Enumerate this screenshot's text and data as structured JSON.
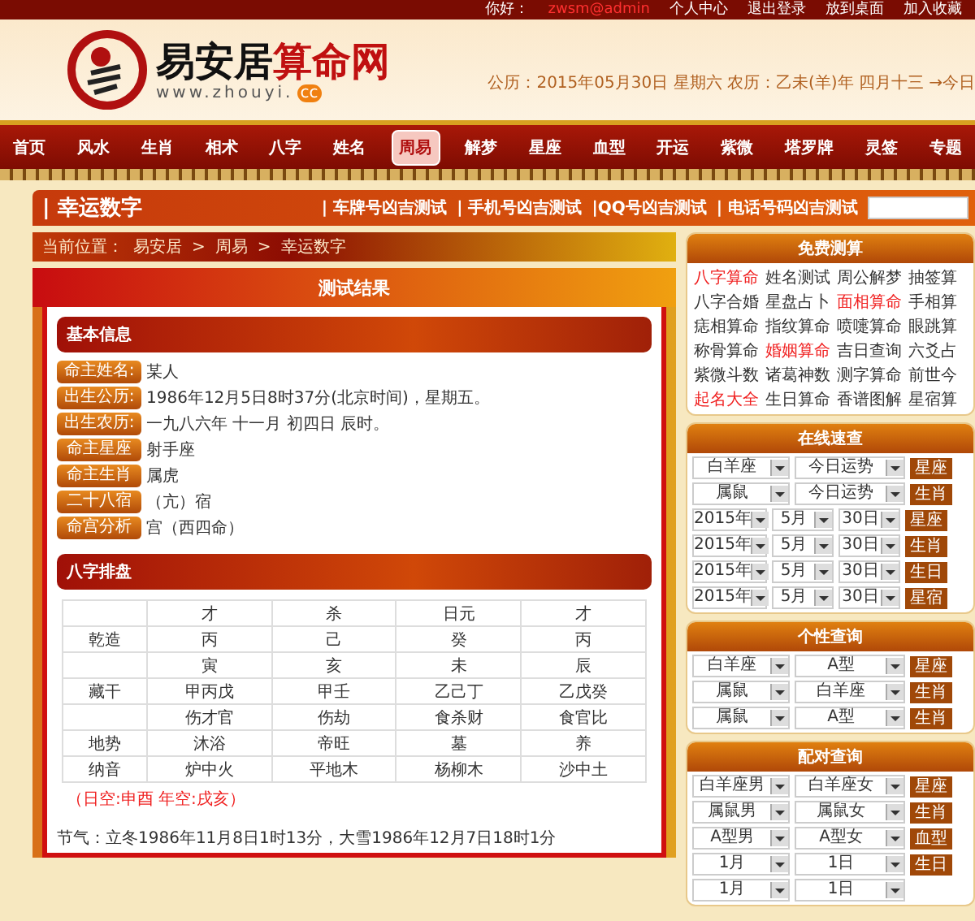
{
  "top_bar": {
    "greeting": "你好：",
    "user": "zwsm@admin",
    "links": [
      "个人中心",
      "退出登录",
      "放到桌面",
      "加入收藏"
    ]
  },
  "header": {
    "logo_title": "易安居",
    "logo_title_accent": "算命网",
    "logo_url": "www.zhouyi.",
    "logo_url_badge": "cc",
    "date": "公历：2015年05月30日 星期六 农历：乙未(羊)年 四月十三 →今日"
  },
  "nav": [
    {
      "label": "首页",
      "selected": false
    },
    {
      "label": "风水",
      "selected": false
    },
    {
      "label": "生肖",
      "selected": false
    },
    {
      "label": "相术",
      "selected": false
    },
    {
      "label": "八字",
      "selected": false
    },
    {
      "label": "姓名",
      "selected": false
    },
    {
      "label": "周易",
      "selected": true
    },
    {
      "label": "解梦",
      "selected": false
    },
    {
      "label": "星座",
      "selected": false
    },
    {
      "label": "血型",
      "selected": false
    },
    {
      "label": "开运",
      "selected": false
    },
    {
      "label": "紫微",
      "selected": false
    },
    {
      "label": "塔罗牌",
      "selected": false
    },
    {
      "label": "灵签",
      "selected": false
    },
    {
      "label": "专题",
      "selected": false
    }
  ],
  "title_bar": {
    "title": "| 幸运数字",
    "links": [
      "| 车牌号凶吉测试",
      "| 手机号凶吉测试",
      "|QQ号凶吉测试",
      "| 电话号码凶吉测试"
    ]
  },
  "breadcrumb": {
    "label": "当前位置：",
    "separator": ">",
    "items": [
      "易安居",
      "周易",
      "幸运数字"
    ]
  },
  "result": {
    "title": "测试结果",
    "basic_heading": "基本信息",
    "basic_rows": [
      {
        "label": "命主姓名:",
        "value": "某人"
      },
      {
        "label": "出生公历:",
        "value": "1986年12月5日8时37分(北京时间)，星期五。"
      },
      {
        "label": "出生农历:",
        "value": "一九八六年 十一月 初四日 辰时。"
      },
      {
        "label": "命主星座",
        "value": "射手座"
      },
      {
        "label": "命主生肖",
        "value": "属虎"
      },
      {
        "label": "二十八宿",
        "value": "（亢）宿"
      },
      {
        "label": "命宫分析",
        "value": "宫（西四命）"
      }
    ],
    "bazi_heading": "八字排盘",
    "bazi_rows": [
      {
        "cells": [
          "才",
          "杀",
          "日元",
          "才"
        ]
      },
      {
        "label": "乾造",
        "cells": [
          "丙",
          "己",
          "癸",
          "丙"
        ]
      },
      {
        "cells": [
          "寅",
          "亥",
          "未",
          "辰"
        ]
      },
      {
        "label": "藏干",
        "cells": [
          "甲丙戊",
          "甲壬",
          "乙己丁",
          "乙戊癸"
        ]
      },
      {
        "cells": [
          "伤才官",
          "伤劫",
          "食杀财",
          "食官比"
        ]
      },
      {
        "label": "地势",
        "cells": [
          "沐浴",
          "帝旺",
          "墓",
          "养"
        ]
      },
      {
        "label": "纳音",
        "cells": [
          "炉中火",
          "平地木",
          "杨柳木",
          "沙中土"
        ]
      }
    ],
    "note": "（日空:申酉 年空:戌亥）",
    "solar_terms": "节气：立冬1986年11月8日1时13分，大雪1986年12月7日18时1分"
  },
  "sidebar": {
    "free": {
      "title": "免费测算",
      "items": [
        {
          "label": "八字算命",
          "hot": true
        },
        {
          "label": "姓名测试",
          "hot": false
        },
        {
          "label": "周公解梦",
          "hot": false
        },
        {
          "label": "抽签算",
          "hot": false
        },
        {
          "label": "八字合婚",
          "hot": false
        },
        {
          "label": "星盘占卜",
          "hot": false
        },
        {
          "label": "面相算命",
          "hot": true
        },
        {
          "label": "手相算",
          "hot": false
        },
        {
          "label": "痣相算命",
          "hot": false
        },
        {
          "label": "指纹算命",
          "hot": false
        },
        {
          "label": "喷嚏算命",
          "hot": false
        },
        {
          "label": "眼跳算",
          "hot": false
        },
        {
          "label": "称骨算命",
          "hot": false
        },
        {
          "label": "婚姻算命",
          "hot": true
        },
        {
          "label": "吉日查询",
          "hot": false
        },
        {
          "label": "六爻占",
          "hot": false
        },
        {
          "label": "紫微斗数",
          "hot": false
        },
        {
          "label": "诸葛神数",
          "hot": false
        },
        {
          "label": "测字算命",
          "hot": false
        },
        {
          "label": "前世今",
          "hot": false
        },
        {
          "label": "起名大全",
          "hot": true
        },
        {
          "label": "生日算命",
          "hot": false
        },
        {
          "label": "香谱图解",
          "hot": false
        },
        {
          "label": "星宿算",
          "hot": false
        }
      ]
    },
    "panels": [
      {
        "title": "在线速查",
        "rows": [
          {
            "selects": [
              "白羊座",
              "今日运势"
            ],
            "button": "星座"
          },
          {
            "selects": [
              "属鼠",
              "今日运势"
            ],
            "button": "生肖"
          },
          {
            "selects": [
              "2015年",
              "5月",
              "30日"
            ],
            "button": "星座"
          },
          {
            "selects": [
              "2015年",
              "5月",
              "30日"
            ],
            "button": "生肖"
          },
          {
            "selects": [
              "2015年",
              "5月",
              "30日"
            ],
            "button": "生日"
          },
          {
            "selects": [
              "2015年",
              "5月",
              "30日"
            ],
            "button": "星宿"
          }
        ]
      },
      {
        "title": "个性查询",
        "rows": [
          {
            "selects": [
              "白羊座",
              "A型"
            ],
            "button": "星座"
          },
          {
            "selects": [
              "属鼠",
              "白羊座"
            ],
            "button": "生肖"
          },
          {
            "selects": [
              "属鼠",
              "A型"
            ],
            "button": "生肖"
          }
        ]
      },
      {
        "title": "配对查询",
        "rows": [
          {
            "selects": [
              "白羊座男",
              "白羊座女"
            ],
            "button": "星座"
          },
          {
            "selects": [
              "属鼠男",
              "属鼠女"
            ],
            "button": "生肖"
          },
          {
            "selects": [
              "A型男",
              "A型女"
            ],
            "button": "血型"
          },
          {
            "selects": [
              "1月",
              "1日"
            ],
            "button": "生日"
          },
          {
            "selects": [
              "1月",
              "1日"
            ]
          }
        ]
      }
    ]
  }
}
